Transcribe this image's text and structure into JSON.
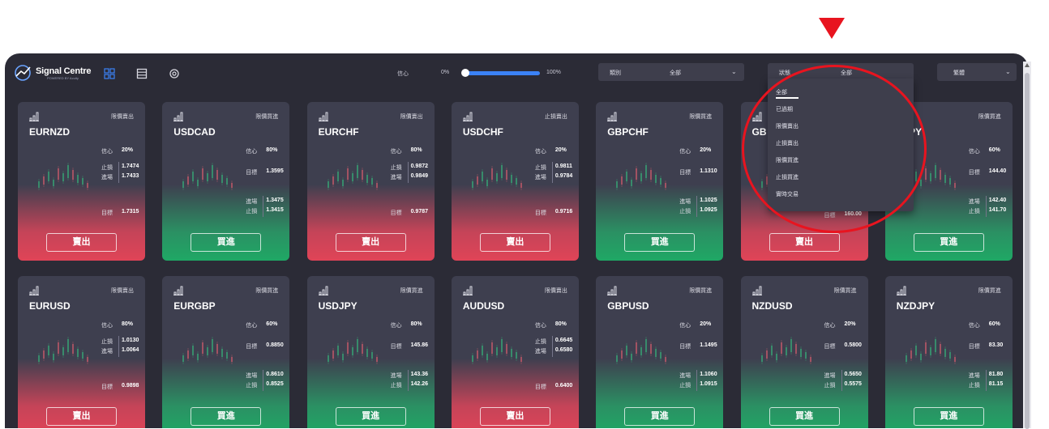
{
  "header": {
    "logo_title": "Signal Centre",
    "logo_sub": "POWERED BY Acuity",
    "confidence_label": "信心",
    "confidence_min": "0%",
    "confidence_max": "100%",
    "category": {
      "label": "類別",
      "value": "全部"
    },
    "state": {
      "label": "狀態",
      "value": "全部"
    },
    "language": {
      "value": "繁體"
    }
  },
  "dropdown": {
    "options": [
      "全部",
      "已過期",
      "限價賣出",
      "止損賣出",
      "限價買進",
      "止損買進",
      "實時交易"
    ],
    "selected": 0
  },
  "labels": {
    "confidence": "信心",
    "stop": "止損",
    "entry": "進場",
    "target": "目標"
  },
  "cards": [
    {
      "pair": "EURNZD",
      "status": "限價賣出",
      "side": "sell",
      "button": "賣出",
      "confidence": "20%",
      "stop": "1.7474",
      "entry": "1.7433",
      "target": "1.7315"
    },
    {
      "pair": "USDCAD",
      "status": "限價買進",
      "side": "buy",
      "button": "買進",
      "confidence": "80%",
      "target": "1.3595",
      "entry": "1.3475",
      "stop": "1.3415"
    },
    {
      "pair": "EURCHF",
      "status": "限價賣出",
      "side": "sell",
      "button": "賣出",
      "confidence": "80%",
      "stop": "0.9872",
      "entry": "0.9849",
      "target": "0.9787"
    },
    {
      "pair": "USDCHF",
      "status": "止損賣出",
      "side": "sell",
      "button": "賣出",
      "confidence": "20%",
      "stop": "0.9811",
      "entry": "0.9784",
      "target": "0.9716"
    },
    {
      "pair": "GBPCHF",
      "status": "限價買進",
      "side": "buy",
      "button": "買進",
      "confidence": "20%",
      "target": "1.1310",
      "entry": "1.1025",
      "stop": "1.0925"
    },
    {
      "pair": "GB",
      "status": "",
      "side": "sell",
      "button": "賣出",
      "target_label": "目標",
      "target": "160.00"
    },
    {
      "pair": "RJPY",
      "status": "限價買進",
      "side": "buy",
      "button": "買進",
      "confidence": "60%",
      "target": "144.40",
      "entry": "142.40",
      "stop": "141.70"
    },
    {
      "pair": "EURUSD",
      "status": "限價賣出",
      "side": "sell",
      "button": "賣出",
      "confidence": "80%",
      "stop": "1.0130",
      "entry": "1.0064",
      "target": "0.9898"
    },
    {
      "pair": "EURGBP",
      "status": "限價買進",
      "side": "buy",
      "button": "買進",
      "confidence": "60%",
      "target": "0.8850",
      "entry": "0.8610",
      "stop": "0.8525"
    },
    {
      "pair": "USDJPY",
      "status": "限價買進",
      "side": "buy",
      "button": "買進",
      "confidence": "80%",
      "target": "145.86",
      "entry": "143.36",
      "stop": "142.26"
    },
    {
      "pair": "AUDUSD",
      "status": "限價賣出",
      "side": "sell",
      "button": "賣出",
      "confidence": "80%",
      "stop": "0.6645",
      "entry": "0.6580",
      "target": "0.6400"
    },
    {
      "pair": "GBPUSD",
      "status": "限價買進",
      "side": "buy",
      "button": "買進",
      "confidence": "20%",
      "target": "1.1495",
      "entry": "1.1060",
      "stop": "1.0915"
    },
    {
      "pair": "NZDUSD",
      "status": "限價買進",
      "side": "buy",
      "button": "買進",
      "confidence": "20%",
      "target": "0.5800",
      "entry": "0.5650",
      "stop": "0.5575"
    },
    {
      "pair": "NZDJPY",
      "status": "限價買進",
      "side": "buy",
      "button": "買進",
      "confidence": "60%",
      "target": "83.30",
      "entry": "81.80",
      "stop": "81.15"
    }
  ],
  "colors": {
    "sell": "#e04457",
    "buy": "#1fa865",
    "accent": "#3b82f6",
    "annotation": "#e8141f"
  },
  "icons": [
    "logo-icon",
    "grid-view-icon",
    "list-view-icon",
    "settings-icon",
    "signal-bars-icon",
    "chevron-down-icon",
    "candlestick-icon"
  ]
}
